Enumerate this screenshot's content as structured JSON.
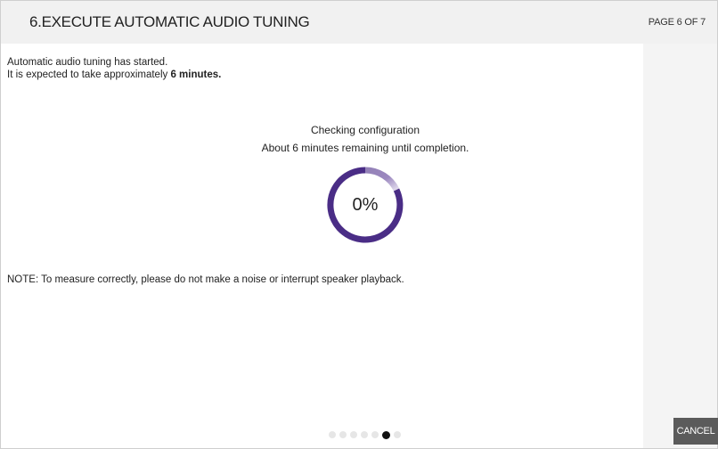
{
  "header": {
    "title": "6.EXECUTE AUTOMATIC AUDIO TUNING",
    "page_label": "PAGE 6 OF 7"
  },
  "intro": {
    "line1": "Automatic audio tuning has started.",
    "line2_prefix": "It is expected to take approximately ",
    "line2_bold": "6 minutes."
  },
  "status": {
    "title": "Checking configuration",
    "subtitle": "About 6 minutes remaining until completion."
  },
  "progress": {
    "percent_text": "0%",
    "value": 0,
    "ring_color": "#4a2d86"
  },
  "note": "NOTE: To measure correctly, please do not make a noise or interrupt speaker playback.",
  "pagination": {
    "total": 7,
    "current": 6
  },
  "actions": {
    "cancel_label": "CANCEL"
  }
}
